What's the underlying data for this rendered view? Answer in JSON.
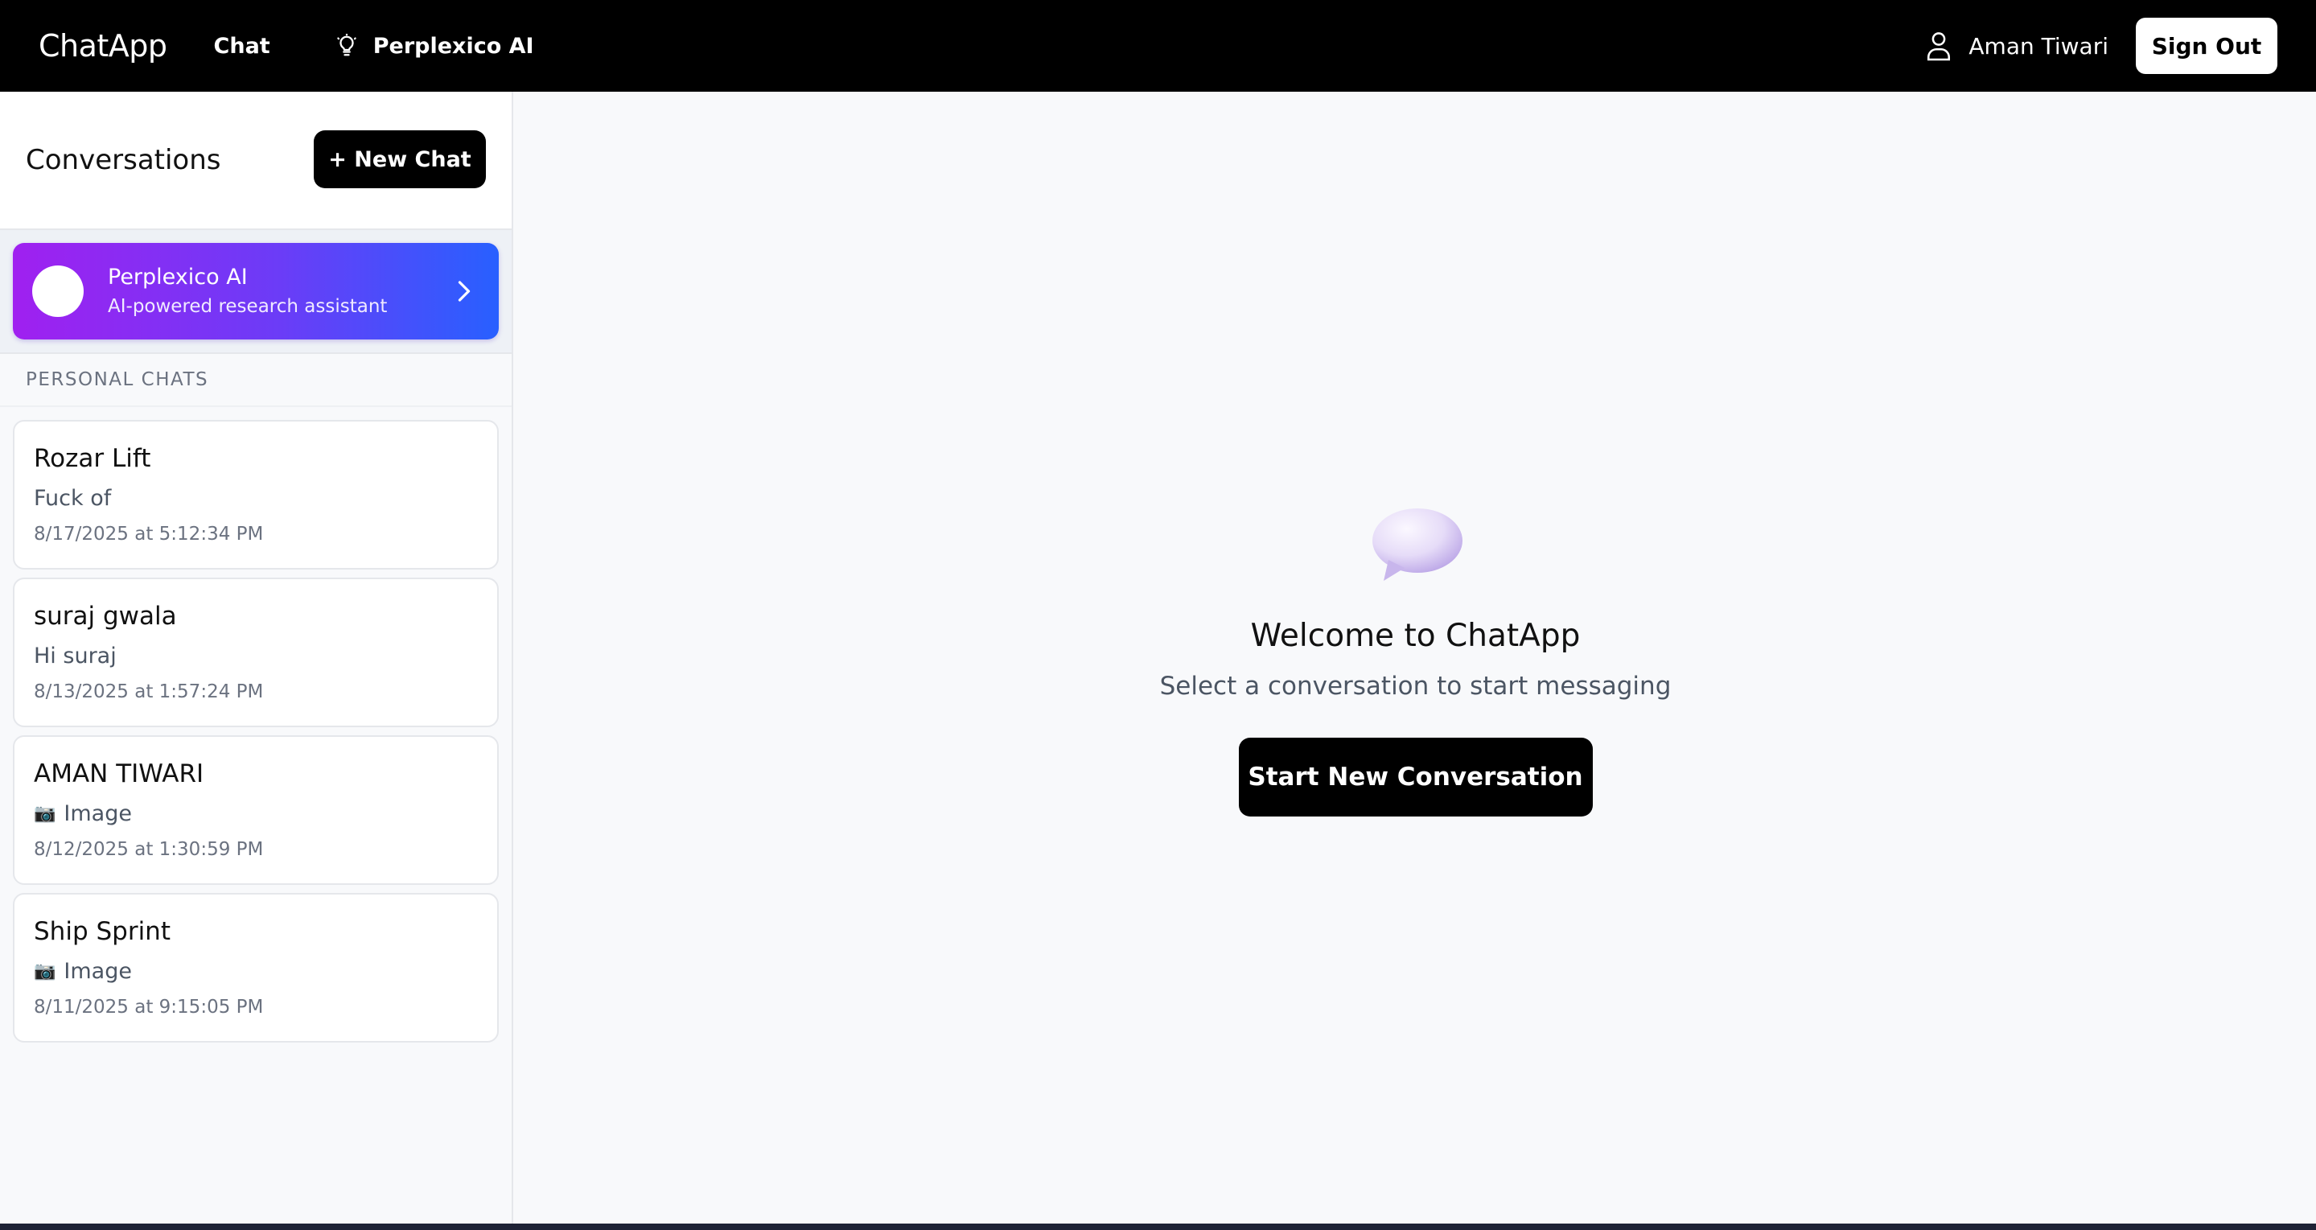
{
  "header": {
    "brand": "ChatApp",
    "nav": {
      "chat_label": "Chat",
      "ai_label": "Perplexico AI"
    },
    "user_name": "Aman Tiwari",
    "signout_label": "Sign Out"
  },
  "sidebar": {
    "title": "Conversations",
    "new_chat_label": "+ New Chat",
    "ai_card": {
      "name": "Perplexico AI",
      "subtitle": "AI-powered research assistant",
      "gradient_start": "#a020f0",
      "gradient_end": "#2860ff"
    },
    "section_label": "PERSONAL CHATS",
    "chats": [
      {
        "name": "Rozar Lift",
        "last_message": "Fuck of",
        "timestamp": "8/17/2025 at 5:12:34 PM",
        "icon": ""
      },
      {
        "name": "suraj gwala",
        "last_message": "Hi suraj",
        "timestamp": "8/13/2025 at 1:57:24 PM",
        "icon": ""
      },
      {
        "name": "AMAN TIWARI",
        "last_message": "Image",
        "timestamp": "8/12/2025 at 1:30:59 PM",
        "icon": "📷"
      },
      {
        "name": "Ship Sprint",
        "last_message": "Image",
        "timestamp": "8/11/2025 at 9:15:05 PM",
        "icon": "📷"
      }
    ]
  },
  "main": {
    "welcome_title": "Welcome to ChatApp",
    "welcome_subtitle": "Select a conversation to start messaging",
    "start_button_label": "Start New Conversation"
  },
  "colors": {
    "topbar_bg": "#000000",
    "page_bg": "#f8f9fb",
    "primary_button": "#000000"
  },
  "icons": {
    "nav_ai": "lightbulb-icon",
    "user": "user-icon",
    "ai_chevron": "chevron-right-icon",
    "welcome": "speech-bubble-icon",
    "attachment": "camera-icon"
  }
}
